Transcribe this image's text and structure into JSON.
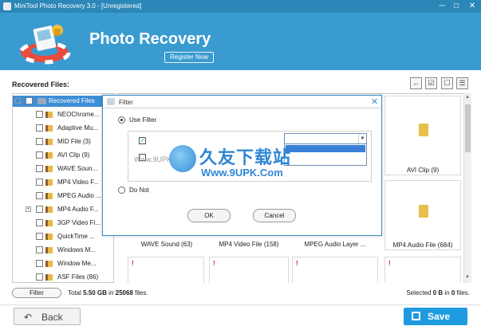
{
  "window": {
    "title": "MiniTool Photo Recovery 3.0 - [Unregistered]",
    "controls": [
      "─",
      "□",
      "✕"
    ]
  },
  "header": {
    "app_title": "Photo Recovery",
    "register_label": "Register Now"
  },
  "toolbar": {
    "recovered_files_label": "Recovered Files:",
    "buttons": [
      "←",
      "☑",
      "☐",
      "☰"
    ]
  },
  "tree": {
    "root": "Recovered Files",
    "items": [
      "NEOChrome...",
      "Adaptive Mu...",
      "MID File (3)",
      "AVI Clip (9)",
      "WAVE Soun...",
      "MP4 Video F...",
      "MPEG Audio ...",
      "MP4 Audio F...",
      "3GP Video Fi...",
      "QuickTime ...",
      "Windows M...",
      "Window Me...",
      "ASF Files (86)"
    ]
  },
  "grid": {
    "row1_right_caption": "AVI Clip (9)",
    "row2_captions": [
      "WAVE Sound (63)",
      "MP4 Video File (158)",
      "MPEG Audio Layer ...",
      "MP4 Audio File (684)"
    ],
    "red_mark": "!"
  },
  "status": {
    "filter_label": "Filter",
    "total_prefix": "Total",
    "total_size": "5.50 GB",
    "total_in": "in",
    "total_count": "25068",
    "total_suffix": "files.",
    "selected_prefix": "Selected",
    "selected_size": "0 B",
    "selected_in": "in",
    "selected_count": "0",
    "selected_suffix": "files."
  },
  "footer": {
    "back_label": "Back",
    "save_label": "Save"
  },
  "dialog": {
    "title": "Filter",
    "use_filter_label": "Use Filter",
    "do_not_label": "Do Not",
    "ok_label": "OK",
    "cancel_label": "Cancel"
  },
  "watermark": {
    "title": "久友下载站",
    "url": "Www.9UPK.Com",
    "faint": "Www.9UPK.Com"
  },
  "colors": {
    "header_blue": "#3a9bd0",
    "titlebar_blue": "#2b87b8",
    "selection_blue": "#3d8ed6",
    "save_blue": "#1e9be0",
    "folder_yellow": "#e8b84a"
  }
}
